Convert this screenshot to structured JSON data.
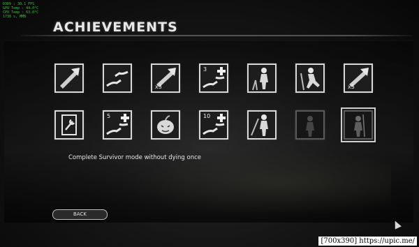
{
  "perf_overlay": {
    "lines": [
      "D3D9 : 30.1 FPS",
      "GPU Temp : 44.0°C",
      "CPU Temp : 63.0°C",
      "1738 s, MMB"
    ]
  },
  "header": {
    "title": "ACHIEVEMENTS"
  },
  "achievements": {
    "row1": [
      {
        "icon": "axe-icon",
        "badge": ""
      },
      {
        "icon": "hands-handoff-icon",
        "badge": ""
      },
      {
        "icon": "axe-icon",
        "badge": "x3"
      },
      {
        "icon": "hands-medkit-icon",
        "badge": "3"
      },
      {
        "icon": "survivor-standing-icon",
        "badge": ""
      },
      {
        "icon": "survivor-crouching-icon",
        "badge": ""
      },
      {
        "icon": "axe-icon",
        "badge": "x5"
      }
    ],
    "row2": [
      {
        "icon": "clipboard-wrench-icon",
        "badge": ""
      },
      {
        "icon": "hands-medkit-icon",
        "badge": "5"
      },
      {
        "icon": "pumpkin-icon",
        "badge": ""
      },
      {
        "icon": "hands-medkit-icon",
        "badge": "10"
      },
      {
        "icon": "survivor-pole-icon",
        "badge": ""
      },
      {
        "icon": "survivor-silhouette-icon",
        "badge": "",
        "locked": true
      },
      {
        "icon": "survivor-spear-icon",
        "badge": "",
        "locked": true,
        "selected": true
      }
    ]
  },
  "selected_description": "Complete Survivor mode without dying once",
  "footer": {
    "back_label": "BACK"
  },
  "watermark": "[700x390] https://upic.me/"
}
